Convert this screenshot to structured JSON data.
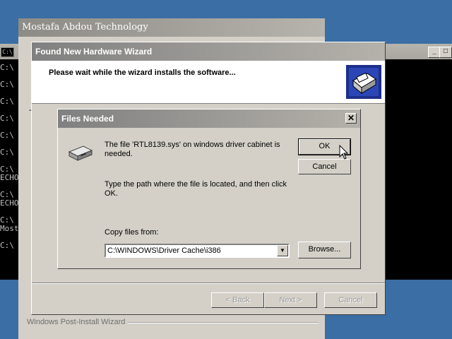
{
  "console": {
    "icon_text": "C:\\",
    "lines": [
      "C:\\",
      "C:\\",
      "C:\\",
      "C:\\",
      "C:\\",
      "C:\\",
      "C:\\",
      "ECHO",
      "C:\\",
      "ECHO",
      "C:\\",
      "Most",
      "C:\\"
    ],
    "minimize_label": "_",
    "maximize_label": "□"
  },
  "mostafa_window": {
    "title": "Mostafa Abdou Technology",
    "footer_label": "Windows Post-Install Wizard"
  },
  "wizard": {
    "title": "Found New Hardware Wizard",
    "subtitle": "Please wait while the wizard installs the software...",
    "back_label": "< Back",
    "next_label": "Next >",
    "cancel_label": "Cancel",
    "fragment": "-"
  },
  "dialog": {
    "title": "Files Needed",
    "close_label": "✕",
    "message_line1": "The file 'RTL8139.sys' on windows driver cabinet is needed.",
    "message_line2": "Type the path where the file is located, and then click OK.",
    "copy_from_label": "Copy files from:",
    "copy_from_value": "C:\\WINDOWS\\Driver Cache\\i386",
    "ok_label": "OK",
    "cancel_label": "Cancel",
    "browse_label": "Browse..."
  },
  "icons": {
    "disk": "disk-drive-icon",
    "wizard_logo": "hardware-wizard-icon",
    "cursor": "mouse-cursor-icon"
  }
}
